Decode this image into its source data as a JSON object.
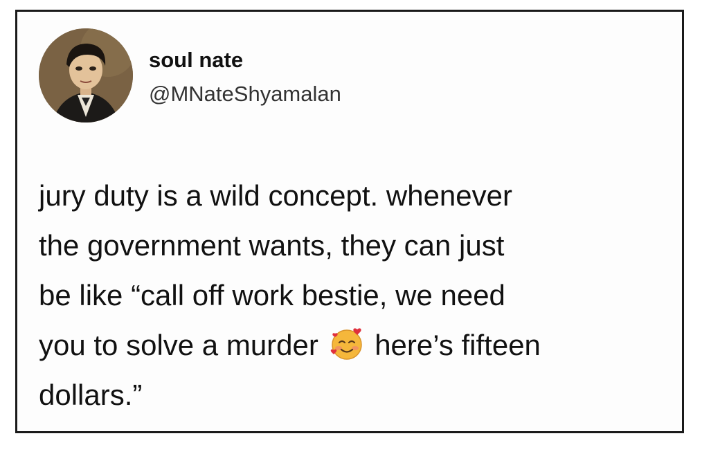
{
  "author": {
    "display_name": "soul nate",
    "handle": "@MNateShyamalan",
    "avatar_icon": "profile-avatar"
  },
  "tweet": {
    "lines": [
      "jury duty is a wild concept. whenever",
      "the government wants, they can just",
      "be like “call off work bestie, we need"
    ],
    "line4_before_emoji": "you to solve a murder ",
    "emoji_name": "smiling-face-with-hearts-icon",
    "line4_after_emoji": " here’s fifteen",
    "line5": "dollars.”"
  },
  "colors": {
    "text": "#111111",
    "border": "#1a1a1a",
    "background": "#fdfdfd"
  }
}
